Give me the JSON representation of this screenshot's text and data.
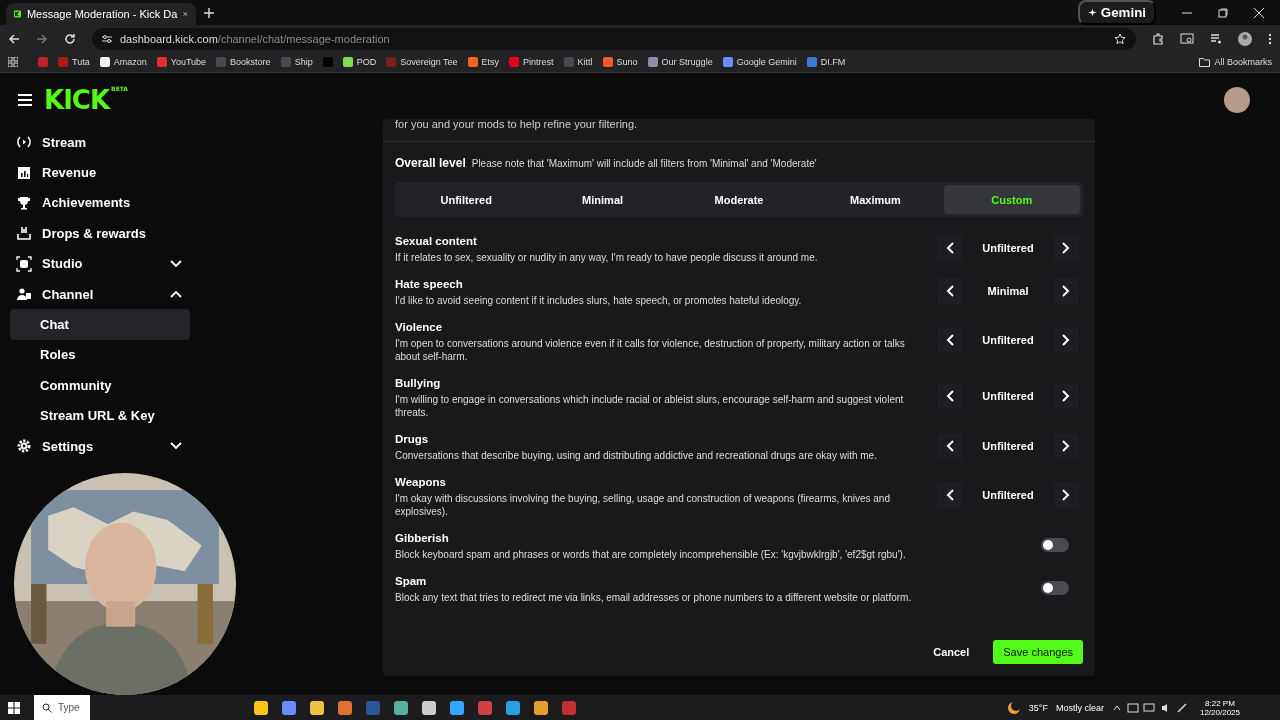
{
  "browser": {
    "tab_title": "Message Moderation - Kick Da",
    "gemini": "Gemini",
    "domain": "dashboard.kick.com",
    "path": "/channel/chat/message-moderation",
    "bookmarks": [
      {
        "label": "Tuta",
        "color": "#b01818"
      },
      {
        "label": "Amazon",
        "color": "#f0f0f0"
      },
      {
        "label": "YouTube",
        "color": "#e52d27"
      },
      {
        "label": "Bookstore",
        "color": "#4a4a4e"
      },
      {
        "label": "Ship",
        "color": "#4a4a4e"
      },
      {
        "color": "#000000"
      },
      {
        "label": "POD",
        "color": "#7ed957"
      },
      {
        "label": "Sovereign Tee",
        "color": "#7a1f1f"
      },
      {
        "label": "Etsy",
        "color": "#f1641e"
      },
      {
        "label": "Pintrest",
        "color": "#e60023"
      },
      {
        "label": "Kittl",
        "color": "#4a4a4e"
      },
      {
        "label": "Suno",
        "color": "#f05a28"
      },
      {
        "label": "Our Struggle",
        "color": "#8a8fa8"
      },
      {
        "label": "Google Gemini",
        "color": "#6a8cff"
      },
      {
        "label": "DI.FM",
        "color": "#3a7bd5"
      }
    ],
    "all_bookmarks": "All Bookmarks"
  },
  "sidebar": {
    "logo": "KICK",
    "logo_badge": "BETA",
    "items": [
      {
        "label": "Stream",
        "selected": false
      },
      {
        "label": "Revenue",
        "selected": false
      },
      {
        "label": "Achievements",
        "selected": false
      },
      {
        "label": "Drops & rewards",
        "selected": false
      },
      {
        "label": "Studio",
        "expanded": false,
        "selected": false
      },
      {
        "label": "Channel",
        "expanded": true,
        "selected": false,
        "children": [
          {
            "label": "Chat",
            "selected": true
          },
          {
            "label": "Roles",
            "selected": false
          },
          {
            "label": "Community",
            "selected": false
          },
          {
            "label": "Stream URL & Key",
            "selected": false
          }
        ]
      },
      {
        "label": "Settings",
        "expanded": false,
        "selected": false
      }
    ]
  },
  "moderation": {
    "intro_tail": "for you and your mods to help refine your filtering.",
    "overall_label": "Overall level",
    "overall_note": "Please note that 'Maximum' will include all filters from 'Minimal' and 'Moderate'",
    "levels": [
      {
        "label": "Unfiltered",
        "selected": false
      },
      {
        "label": "Minimal",
        "selected": false
      },
      {
        "label": "Moderate",
        "selected": false
      },
      {
        "label": "Maximum",
        "selected": false
      },
      {
        "label": "Custom",
        "selected": true
      }
    ],
    "categories": [
      {
        "kind": "stepper",
        "title": "Sexual content",
        "description": "If it relates to sex, sexuality or nudity in any way, I'm ready to have people discuss it around me.",
        "value": "Unfiltered"
      },
      {
        "kind": "stepper",
        "title": "Hate speech",
        "description": "I'd like to avoid seeing content if it includes slurs, hate speech, or promotes hateful ideology.",
        "value": "Minimal"
      },
      {
        "kind": "stepper",
        "title": "Violence",
        "description": "I'm open to conversations around violence even if it calls for violence, destruction of property, military action or talks about self-harm.",
        "value": "Unfiltered"
      },
      {
        "kind": "stepper",
        "title": "Bullying",
        "description": "I'm willing to engage in conversations which include racial or ableist slurs, encourage self-harm and suggest violent threats.",
        "value": "Unfiltered"
      },
      {
        "kind": "stepper",
        "title": "Drugs",
        "description": "Conversations that describe buying, using and distributing addictive and recreational drugs are okay with me.",
        "value": "Unfiltered"
      },
      {
        "kind": "stepper",
        "title": "Weapons",
        "description": "I'm okay with discussions involving the buying, selling, usage and construction of weapons (firearms, knives and explosives).",
        "value": "Unfiltered"
      },
      {
        "kind": "toggle",
        "title": "Gibberish",
        "description": "Block keyboard spam and phrases or words that are completely incomprehensible (Ex: 'kgvjbwklrgjb', 'ef2$gt rgbu').",
        "on": false
      },
      {
        "kind": "toggle",
        "title": "Spam",
        "description": "Block any text that tries to redirect me via links, email addresses or phone numbers to a different website or platform.",
        "on": false
      }
    ],
    "cancel": "Cancel",
    "save": "Save changes"
  },
  "taskbar": {
    "search_placeholder": "Type",
    "temperature": "35°F",
    "weather": "Mostly clear",
    "time": "8:22 PM",
    "date": "12/20/2025"
  }
}
